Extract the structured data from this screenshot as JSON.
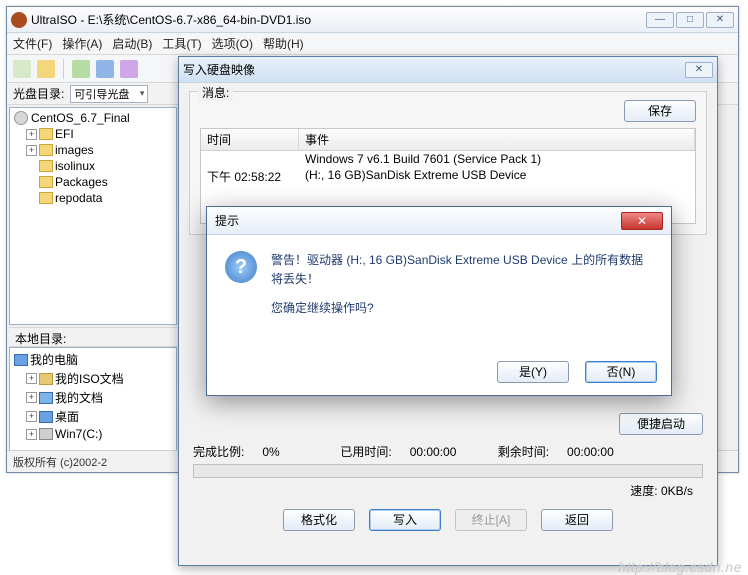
{
  "main": {
    "title": "UltraISO - E:\\系统\\CentOS-6.7-x86_64-bin-DVD1.iso",
    "menu": [
      "文件(F)",
      "操作(A)",
      "启动(B)",
      "工具(T)",
      "选项(O)",
      "帮助(H)"
    ],
    "disc_dir_label": "光盘目录:",
    "combo_value": "可引导光盘",
    "tree_top": {
      "root": "CentOS_6.7_Final",
      "items": [
        "EFI",
        "images",
        "isolinux",
        "Packages",
        "repodata"
      ]
    },
    "local_dir_label": "本地目录:",
    "tree_local": {
      "root": "我的电脑",
      "items": [
        "我的ISO文档",
        "我的文档",
        "桌面",
        "Win7(C:)"
      ]
    },
    "status": "版权所有 (c)2002-2"
  },
  "write": {
    "title": "写入硬盘映像",
    "msg_legend": "消息:",
    "save": "保存",
    "col_time": "时间",
    "col_event": "事件",
    "rows": [
      {
        "t": "",
        "e": "Windows 7 v6.1 Build 7601 (Service Pack 1)"
      },
      {
        "t": "下午 02:58:22",
        "e": "(H:, 16 GB)SanDisk Extreme USB Device"
      }
    ],
    "boot_hint": "便捷启动",
    "progress_label": "完成比例:",
    "progress_val": "0%",
    "elapsed_label": "已用时间:",
    "elapsed_val": "00:00:00",
    "remain_label": "剩余时间:",
    "remain_val": "00:00:00",
    "speed_label": "速度:",
    "speed_val": "0KB/s",
    "btns": {
      "format": "格式化",
      "write": "写入",
      "abort": "终止[A]",
      "back": "返回"
    }
  },
  "prompt": {
    "title": "提示",
    "line1": "警告！驱动器 (H:, 16 GB)SanDisk Extreme USB Device 上的所有数据将丢失！",
    "line2": "您确定继续操作吗?",
    "yes": "是(Y)",
    "no": "否(N)"
  },
  "watermark": "http://blog.csdn.ne"
}
